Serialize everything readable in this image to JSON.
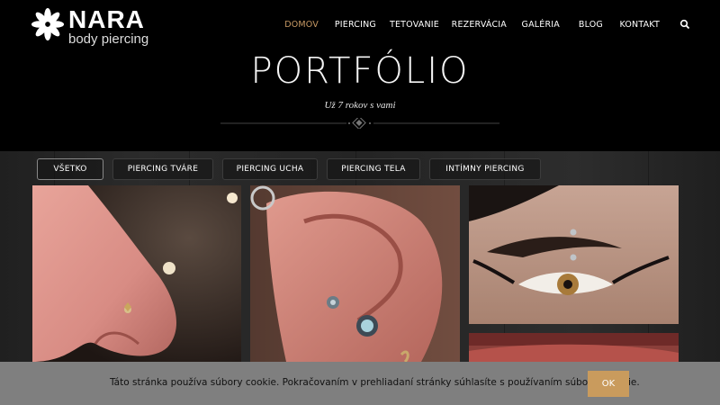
{
  "brand": {
    "name": "NARA",
    "tagline": "body piercing",
    "logo_icon": "flower-icon"
  },
  "nav": {
    "items": [
      "DOMOV",
      "PIERCING",
      "TETOVANIE",
      "REZERVÁCIA",
      "GALÉRIA",
      "BLOG",
      "KONTAKT"
    ],
    "active": "DOMOV",
    "search_icon": "search-icon"
  },
  "hero": {
    "title": "PORTFÓLIO",
    "subtitle": "Už 7 rokov s vami"
  },
  "filters": {
    "items": [
      "VŠETKO",
      "PIERCING TVÁRE",
      "PIERCING UCHA",
      "PIERCING TELA",
      "INTÍMNY PIERCING"
    ],
    "active": "VŠETKO"
  },
  "cookie": {
    "text": "Táto stránka používa súbory cookie. Pokračovaním v prehliadaní stránky súhlasíte s používaním súborov cookie.",
    "button": "OK"
  },
  "colors": {
    "accent": "#c99b5d",
    "nav_active": "#c99b65",
    "cookie_bg": "#7f7f7f"
  }
}
